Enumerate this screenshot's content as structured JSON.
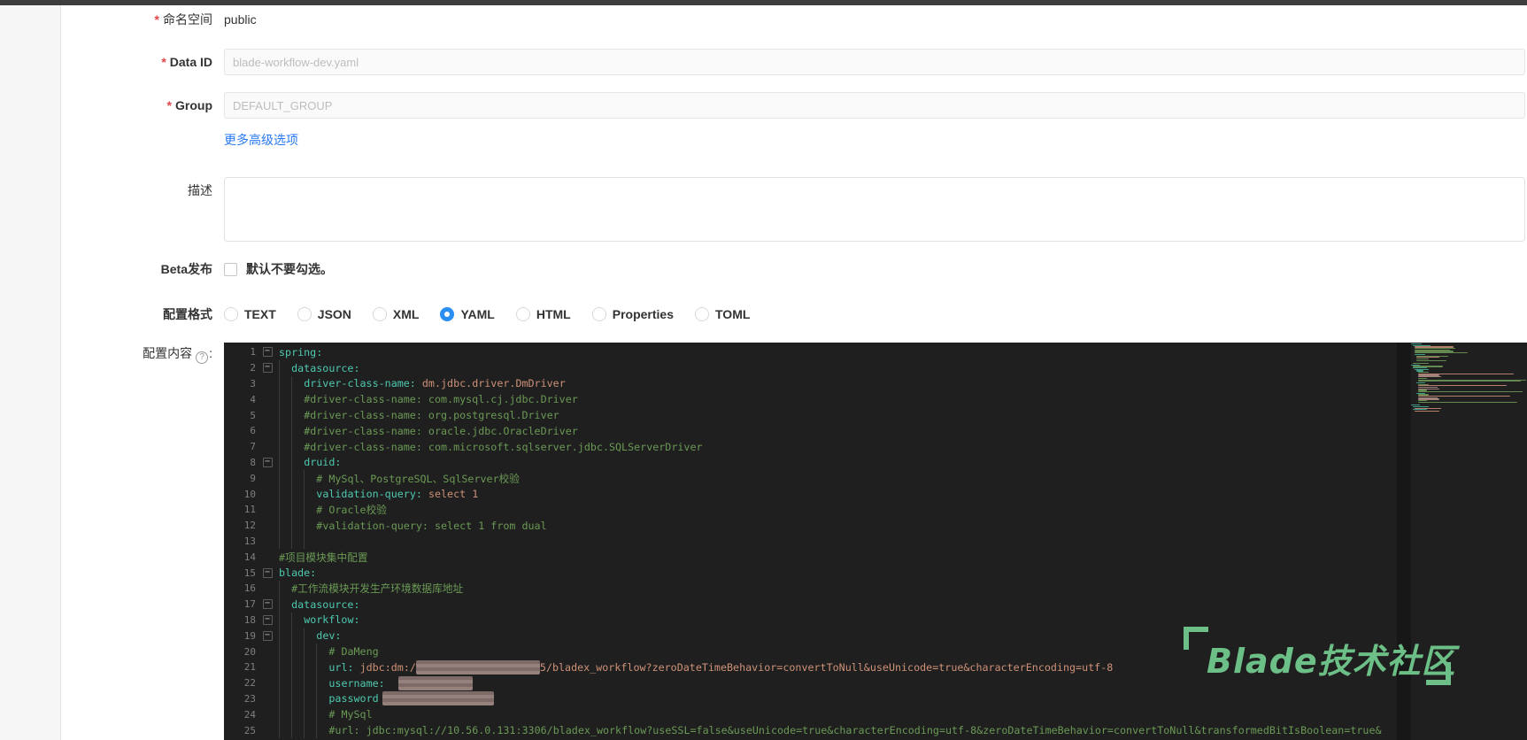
{
  "form": {
    "required_marker": "*",
    "namespace_label": "命名空间",
    "namespace_value": "public",
    "data_id_label": "Data ID",
    "data_id_placeholder": "blade-workflow-dev.yaml",
    "group_label": "Group",
    "group_placeholder": "DEFAULT_GROUP",
    "advanced_link": "更多高级选项",
    "description_label": "描述",
    "description_value": "",
    "beta_label": "Beta发布",
    "beta_hint": "默认不要勾选。",
    "beta_checked": false,
    "format_label": "配置格式",
    "format_options": [
      "TEXT",
      "JSON",
      "XML",
      "YAML",
      "HTML",
      "Properties",
      "TOML"
    ],
    "format_selected": "YAML",
    "format_selected_color": "#2b8ef3",
    "content_label": "配置内容",
    "content_help": "?",
    "content_colon": ":",
    "link_color": "#2979f2",
    "required_color": "#e54545"
  },
  "editor": {
    "background": "#1f1f1f",
    "colors": {
      "k": "#4ec9b0",
      "v": "#ce9178",
      "c": "#6a9955",
      "ln": "#7f7f7f"
    },
    "watermark_text": "Blade技术社区",
    "watermark_color": "#6cbf86",
    "lines": [
      {
        "n": 1,
        "fold": true,
        "g": 0,
        "s": [
          [
            "k",
            "spring:"
          ]
        ]
      },
      {
        "n": 2,
        "fold": true,
        "g": 1,
        "s": [
          [
            "k",
            "datasource:"
          ]
        ]
      },
      {
        "n": 3,
        "fold": false,
        "g": 2,
        "s": [
          [
            "k",
            "driver-class-name:"
          ],
          [
            "v",
            " dm.jdbc.driver.DmDriver"
          ]
        ]
      },
      {
        "n": 4,
        "fold": false,
        "g": 2,
        "s": [
          [
            "c",
            "#driver-class-name: com.mysql.cj.jdbc.Driver"
          ]
        ]
      },
      {
        "n": 5,
        "fold": false,
        "g": 2,
        "s": [
          [
            "c",
            "#driver-class-name: org.postgresql.Driver"
          ]
        ]
      },
      {
        "n": 6,
        "fold": false,
        "g": 2,
        "s": [
          [
            "c",
            "#driver-class-name: oracle.jdbc.OracleDriver"
          ]
        ]
      },
      {
        "n": 7,
        "fold": false,
        "g": 2,
        "s": [
          [
            "c",
            "#driver-class-name: com.microsoft.sqlserver.jdbc.SQLServerDriver"
          ]
        ]
      },
      {
        "n": 8,
        "fold": true,
        "g": 2,
        "s": [
          [
            "k",
            "druid:"
          ]
        ]
      },
      {
        "n": 9,
        "fold": false,
        "g": 3,
        "s": [
          [
            "c",
            "# MySql、PostgreSQL、SqlServer校验"
          ]
        ]
      },
      {
        "n": 10,
        "fold": false,
        "g": 3,
        "s": [
          [
            "k",
            "validation-query:"
          ],
          [
            "v",
            " select 1"
          ]
        ]
      },
      {
        "n": 11,
        "fold": false,
        "g": 3,
        "s": [
          [
            "c",
            "# Oracle校验"
          ]
        ]
      },
      {
        "n": 12,
        "fold": false,
        "g": 3,
        "s": [
          [
            "c",
            "#validation-query: select 1 from dual"
          ]
        ]
      },
      {
        "n": 13,
        "fold": false,
        "g": 3,
        "s": []
      },
      {
        "n": 14,
        "fold": false,
        "g": 0,
        "s": [
          [
            "c",
            "#项目模块集中配置"
          ]
        ]
      },
      {
        "n": 15,
        "fold": true,
        "g": 0,
        "s": [
          [
            "k",
            "blade:"
          ]
        ]
      },
      {
        "n": 16,
        "fold": false,
        "g": 1,
        "s": [
          [
            "c",
            "#工作流模块开发生产环境数据库地址"
          ]
        ]
      },
      {
        "n": 17,
        "fold": true,
        "g": 1,
        "s": [
          [
            "k",
            "datasource:"
          ]
        ]
      },
      {
        "n": 18,
        "fold": true,
        "g": 2,
        "s": [
          [
            "k",
            "workflow:"
          ]
        ]
      },
      {
        "n": 19,
        "fold": true,
        "g": 3,
        "s": [
          [
            "k",
            "dev:"
          ]
        ]
      },
      {
        "n": 20,
        "fold": false,
        "g": 4,
        "s": [
          [
            "c",
            "# DaMeng"
          ]
        ]
      },
      {
        "n": 21,
        "fold": false,
        "g": 4,
        "s": [
          [
            "k",
            "url:"
          ],
          [
            "v",
            " jdbc:dm:/"
          ],
          [
            "b",
            "140"
          ],
          [
            "v",
            "5/bladex_workflow?zeroDateTimeBehavior=convertToNull&useUnicode=true&characterEncoding=utf-8"
          ]
        ]
      },
      {
        "n": 22,
        "fold": false,
        "g": 4,
        "s": [
          [
            "k",
            "username:"
          ],
          [
            "v",
            " "
          ],
          [
            "b",
            "84",
            "8"
          ]
        ]
      },
      {
        "n": 23,
        "fold": false,
        "g": 4,
        "s": [
          [
            "k",
            "password"
          ],
          [
            "b",
            "126",
            "4"
          ]
        ]
      },
      {
        "n": 24,
        "fold": false,
        "g": 4,
        "s": [
          [
            "c",
            "# MySql"
          ]
        ]
      },
      {
        "n": 25,
        "fold": false,
        "g": 4,
        "s": [
          [
            "c",
            "#url: jdbc:mysql://10.56.0.131:3306/bladex_workflow?useSSL=false&useUnicode=true&characterEncoding=utf-8&zeroDateTimeBehavior=convertToNull&transformedBitIsBoolean=true&"
          ]
        ]
      }
    ],
    "minimap": [
      [
        0,
        12,
        "t"
      ],
      [
        2,
        20,
        "t"
      ],
      [
        4,
        44,
        "s"
      ],
      [
        4,
        46,
        "g"
      ],
      [
        4,
        40,
        "g"
      ],
      [
        4,
        44,
        "g"
      ],
      [
        4,
        60,
        "g"
      ],
      [
        4,
        12,
        "t"
      ],
      [
        6,
        36,
        "g"
      ],
      [
        6,
        26,
        "s"
      ],
      [
        6,
        14,
        "g"
      ],
      [
        6,
        34,
        "g"
      ],
      [
        0,
        0,
        "g"
      ],
      [
        2,
        18,
        "g"
      ],
      [
        0,
        10,
        "t"
      ],
      [
        2,
        34,
        "g"
      ],
      [
        2,
        16,
        "t"
      ],
      [
        4,
        16,
        "t"
      ],
      [
        6,
        8,
        "t"
      ],
      [
        8,
        12,
        "g"
      ],
      [
        8,
        108,
        "s"
      ],
      [
        8,
        24,
        "p"
      ],
      [
        8,
        26,
        "p"
      ],
      [
        8,
        10,
        "g"
      ],
      [
        8,
        122,
        "g"
      ],
      [
        8,
        116,
        "g"
      ],
      [
        6,
        10,
        "t"
      ],
      [
        8,
        12,
        "g"
      ],
      [
        8,
        100,
        "s"
      ],
      [
        8,
        22,
        "p"
      ],
      [
        8,
        24,
        "p"
      ],
      [
        8,
        10,
        "g"
      ],
      [
        8,
        118,
        "g"
      ],
      [
        6,
        10,
        "t"
      ],
      [
        8,
        12,
        "g"
      ],
      [
        8,
        104,
        "s"
      ],
      [
        8,
        22,
        "p"
      ],
      [
        8,
        24,
        "p"
      ],
      [
        8,
        10,
        "g"
      ],
      [
        8,
        112,
        "g"
      ],
      [
        0,
        0,
        "g"
      ],
      [
        0,
        10,
        "t"
      ],
      [
        2,
        18,
        "t"
      ],
      [
        4,
        30,
        "s"
      ],
      [
        2,
        16,
        "t"
      ],
      [
        4,
        28,
        "s"
      ]
    ]
  }
}
